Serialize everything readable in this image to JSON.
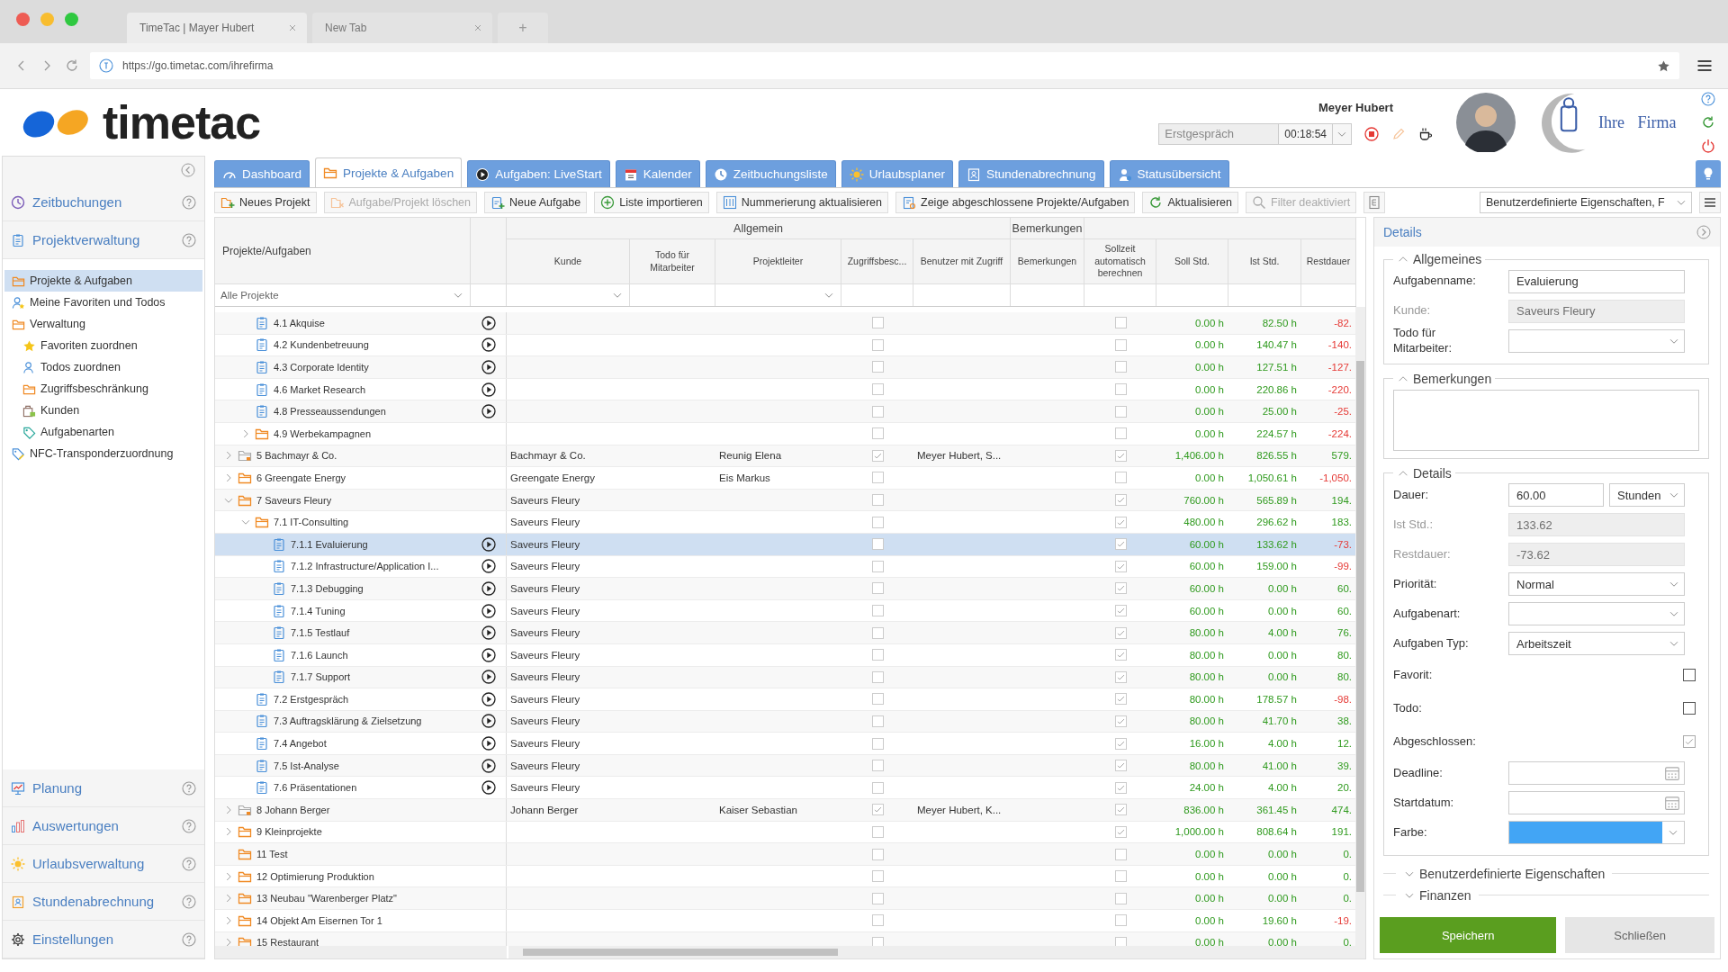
{
  "browser": {
    "tabs": [
      {
        "label": "TimeTac | Mayer Hubert",
        "selected": true
      },
      {
        "label": "New Tab",
        "selected": false
      }
    ],
    "new_tab": "+",
    "url": "https://go.timetac.com/ihrefirma"
  },
  "header": {
    "logo": "timetac",
    "user": "Meyer Hubert",
    "company": "Ihre Firma",
    "tracker": {
      "task": "Erstgespräch",
      "time": "00:18:54"
    }
  },
  "nav_tabs": [
    {
      "label": "Dashboard",
      "selected": false
    },
    {
      "label": "Projekte & Aufgaben",
      "selected": true
    },
    {
      "label": "Aufgaben: LiveStart",
      "selected": false
    },
    {
      "label": "Kalender",
      "selected": false
    },
    {
      "label": "Zeitbuchungsliste",
      "selected": false
    },
    {
      "label": "Urlaubsplaner",
      "selected": false
    },
    {
      "label": "Stundenabrechnung",
      "selected": false
    },
    {
      "label": "Statusübersicht",
      "selected": false
    }
  ],
  "toolbar": {
    "buttons": [
      {
        "label": "Neues Projekt",
        "disabled": false
      },
      {
        "label": "Aufgabe/Projekt löschen",
        "disabled": true
      },
      {
        "label": "Neue Aufgabe",
        "disabled": false
      },
      {
        "label": "Liste importieren",
        "disabled": false
      },
      {
        "label": "Nummerierung aktualisieren",
        "disabled": false
      },
      {
        "label": "Zeige abgeschlossene Projekte/Aufgaben",
        "disabled": false
      },
      {
        "label": "Aktualisieren",
        "disabled": false
      },
      {
        "label": "Filter deaktiviert",
        "disabled": true
      }
    ],
    "properties_select": "Benutzerdefinierte Eigenschaften, F"
  },
  "sidebar": {
    "sections": [
      {
        "label": "Zeitbuchungen"
      },
      {
        "label": "Projektverwaltung",
        "items": [
          {
            "label": "Projekte & Aufgaben",
            "selected": true
          },
          {
            "label": "Meine Favoriten und Todos",
            "selected": false
          },
          {
            "label": "Verwaltung",
            "selected": false,
            "children": [
              {
                "label": "Favoriten zuordnen",
                "selected": false
              },
              {
                "label": "Todos zuordnen",
                "selected": false
              },
              {
                "label": "Zugriffsbeschränkung",
                "selected": false
              },
              {
                "label": "Kunden",
                "selected": false
              },
              {
                "label": "Aufgabenarten",
                "selected": false
              }
            ]
          },
          {
            "label": "NFC-Transponderzuordnung",
            "selected": false
          }
        ]
      },
      {
        "label": "Planung"
      },
      {
        "label": "Auswertungen"
      },
      {
        "label": "Urlaubsverwaltung"
      },
      {
        "label": "Stundenabrechnung"
      },
      {
        "label": "Einstellungen"
      }
    ]
  },
  "table": {
    "name_column": "Projekte/Aufgaben",
    "name_filter": "Alle Projekte",
    "column_groups": [
      {
        "label": "Allgemein",
        "columns": [
          "Kunde",
          "Todo für Mitarbeiter",
          "Projektleiter",
          "Zugriffsbesc...",
          "Benutzer mit Zugriff"
        ]
      },
      {
        "label": "Bemerkungen",
        "columns": [
          "Bemerkungen"
        ]
      },
      {
        "columns": [
          "Sollzeit automatisch berechnen",
          "Soll Std.",
          "Ist Std.",
          "Restdauer"
        ]
      }
    ],
    "rows": [
      {
        "kind": "offscreen",
        "children": [
          {
            "kind": "task",
            "label": "4.1 Akquise",
            "selected": false,
            "access": false,
            "auto": false,
            "soll": "0.00 h",
            "ist": "82.50 h",
            "rest": "-82.",
            "negative": true
          },
          {
            "kind": "task",
            "label": "4.2 Kundenbetreuung",
            "selected": false,
            "access": false,
            "auto": false,
            "soll": "0.00 h",
            "ist": "140.47 h",
            "rest": "-140.",
            "negative": true
          },
          {
            "kind": "task",
            "label": "4.3 Corporate Identity",
            "selected": false,
            "access": false,
            "auto": false,
            "soll": "0.00 h",
            "ist": "127.51 h",
            "rest": "-127.",
            "negative": true
          },
          {
            "kind": "task",
            "label": "4.6 Market Research",
            "selected": false,
            "access": false,
            "auto": false,
            "soll": "0.00 h",
            "ist": "220.86 h",
            "rest": "-220.",
            "negative": true
          },
          {
            "kind": "task",
            "label": "4.8 Presseaussendungen",
            "selected": false,
            "access": false,
            "auto": false,
            "soll": "0.00 h",
            "ist": "25.00 h",
            "rest": "-25.",
            "negative": true
          },
          {
            "kind": "project",
            "label": "4.9 Werbekampagnen",
            "expanded": false,
            "selected": false,
            "access": false,
            "auto": false,
            "soll": "0.00 h",
            "ist": "224.57 h",
            "rest": "-224.",
            "negative": true
          }
        ]
      },
      {
        "kind": "customer_project",
        "label": "5 Bachmayr & Co.",
        "expanded": false,
        "selected": false,
        "customer": "Bachmayr & Co.",
        "lead": "Reunig Elena",
        "users": "Meyer Hubert, S...",
        "access": true,
        "auto": true,
        "soll": "1,406.00 h",
        "ist": "826.55 h",
        "rest": "579.",
        "negative": false
      },
      {
        "kind": "project",
        "label": "6 Greengate Energy",
        "expanded": false,
        "selected": false,
        "customer": "Greengate Energy",
        "lead": "Eis Markus",
        "access": false,
        "auto": false,
        "soll": "0.00 h",
        "ist": "1,050.61 h",
        "rest": "-1,050.",
        "negative": true
      },
      {
        "kind": "project",
        "label": "7 Saveurs Fleury",
        "expanded": true,
        "selected": false,
        "customer": "Saveurs Fleury",
        "access": false,
        "auto": true,
        "soll": "760.00 h",
        "ist": "565.89 h",
        "rest": "194.",
        "negative": false,
        "children": [
          {
            "kind": "project",
            "label": "7.1 IT-Consulting",
            "expanded": true,
            "selected": false,
            "customer": "Saveurs Fleury",
            "access": false,
            "auto": true,
            "soll": "480.00 h",
            "ist": "296.62 h",
            "rest": "183.",
            "negative": false,
            "children": [
              {
                "kind": "task",
                "label": "7.1.1 Evaluierung",
                "selected": true,
                "customer": "Saveurs Fleury",
                "access": false,
                "auto": true,
                "soll": "60.00 h",
                "ist": "133.62 h",
                "rest": "-73.",
                "negative": true
              },
              {
                "kind": "task",
                "label": "7.1.2 Infrastructure/Application I...",
                "selected": false,
                "customer": "Saveurs Fleury",
                "access": false,
                "auto": true,
                "soll": "60.00 h",
                "ist": "159.00 h",
                "rest": "-99.",
                "negative": true
              },
              {
                "kind": "task",
                "label": "7.1.3 Debugging",
                "selected": false,
                "customer": "Saveurs Fleury",
                "access": false,
                "auto": true,
                "soll": "60.00 h",
                "ist": "0.00 h",
                "rest": "60.",
                "negative": false
              },
              {
                "kind": "task",
                "label": "7.1.4 Tuning",
                "selected": false,
                "customer": "Saveurs Fleury",
                "access": false,
                "auto": true,
                "soll": "60.00 h",
                "ist": "0.00 h",
                "rest": "60.",
                "negative": false
              },
              {
                "kind": "task",
                "label": "7.1.5 Testlauf",
                "selected": false,
                "customer": "Saveurs Fleury",
                "access": false,
                "auto": true,
                "soll": "80.00 h",
                "ist": "4.00 h",
                "rest": "76.",
                "negative": false
              },
              {
                "kind": "task",
                "label": "7.1.6 Launch",
                "selected": false,
                "customer": "Saveurs Fleury",
                "access": false,
                "auto": true,
                "soll": "80.00 h",
                "ist": "0.00 h",
                "rest": "80.",
                "negative": false
              },
              {
                "kind": "task",
                "label": "7.1.7 Support",
                "selected": false,
                "customer": "Saveurs Fleury",
                "access": false,
                "auto": true,
                "soll": "80.00 h",
                "ist": "0.00 h",
                "rest": "80.",
                "negative": false
              }
            ]
          },
          {
            "kind": "task",
            "label": "7.2 Erstgespräch",
            "selected": false,
            "customer": "Saveurs Fleury",
            "access": false,
            "auto": true,
            "soll": "80.00 h",
            "ist": "178.57 h",
            "rest": "-98.",
            "negative": true
          },
          {
            "kind": "task",
            "label": "7.3 Auftragsklärung & Zielsetzung",
            "selected": false,
            "customer": "Saveurs Fleury",
            "access": false,
            "auto": true,
            "soll": "80.00 h",
            "ist": "41.70 h",
            "rest": "38.",
            "negative": false
          },
          {
            "kind": "task",
            "label": "7.4 Angebot",
            "selected": false,
            "customer": "Saveurs Fleury",
            "access": false,
            "auto": true,
            "soll": "16.00 h",
            "ist": "4.00 h",
            "rest": "12.",
            "negative": false
          },
          {
            "kind": "task",
            "label": "7.5 Ist-Analyse",
            "selected": false,
            "customer": "Saveurs Fleury",
            "access": false,
            "auto": true,
            "soll": "80.00 h",
            "ist": "41.00 h",
            "rest": "39.",
            "negative": false
          },
          {
            "kind": "task",
            "label": "7.6 Präsentationen",
            "selected": false,
            "customer": "Saveurs Fleury",
            "access": false,
            "auto": true,
            "soll": "24.00 h",
            "ist": "4.00 h",
            "rest": "20.",
            "negative": false
          }
        ]
      },
      {
        "kind": "customer_project",
        "label": "8 Johann Berger",
        "expanded": false,
        "selected": false,
        "customer": "Johann Berger",
        "lead": "Kaiser Sebastian",
        "users": "Meyer Hubert, K...",
        "access": true,
        "auto": true,
        "soll": "836.00 h",
        "ist": "361.45 h",
        "rest": "474.",
        "negative": false
      },
      {
        "kind": "project",
        "label": "9 Kleinprojekte",
        "expanded": false,
        "selected": false,
        "access": false,
        "auto": true,
        "soll": "1,000.00 h",
        "ist": "808.64 h",
        "rest": "191.",
        "negative": false
      },
      {
        "kind": "project",
        "label": "11 Test",
        "selected": false,
        "access": false,
        "auto": false,
        "soll": "0.00 h",
        "ist": "0.00 h",
        "rest": "0.",
        "negative": false
      },
      {
        "kind": "project",
        "label": "12 Optimierung Produktion",
        "expanded": false,
        "selected": false,
        "access": false,
        "auto": false,
        "soll": "0.00 h",
        "ist": "0.00 h",
        "rest": "0.",
        "negative": false
      },
      {
        "kind": "project",
        "label": "13 Neubau \"Warenberger Platz\"",
        "expanded": false,
        "selected": false,
        "access": false,
        "auto": false,
        "soll": "0.00 h",
        "ist": "0.00 h",
        "rest": "0.",
        "negative": false
      },
      {
        "kind": "project",
        "label": "14 Objekt Am Eisernen Tor 1",
        "expanded": false,
        "selected": false,
        "access": false,
        "auto": false,
        "soll": "0.00 h",
        "ist": "19.60 h",
        "rest": "-19.",
        "negative": true
      },
      {
        "kind": "project",
        "label": "15 Restaurant",
        "expanded": false,
        "selected": false,
        "access": false,
        "auto": false,
        "soll": "0.00 h",
        "ist": "0.00 h",
        "rest": "0.",
        "negative": false
      }
    ]
  },
  "details": {
    "title": "Details",
    "sections": [
      {
        "title": "Allgemeines",
        "expanded": true,
        "fields": [
          {
            "kind": "input",
            "label": "Aufgabenname:",
            "value": "Evaluierung"
          },
          {
            "kind": "readonly",
            "label": "Kunde:",
            "value": "Saveurs Fleury"
          },
          {
            "kind": "select",
            "label": "Todo für Mitarbeiter:"
          }
        ]
      },
      {
        "title": "Bemerkungen",
        "expanded": true,
        "fields": [
          {
            "kind": "textarea"
          }
        ]
      },
      {
        "title": "Details",
        "expanded": true,
        "fields": [
          {
            "kind": "duration",
            "label": "Dauer:",
            "value": "60.00",
            "unit": "Stunden"
          },
          {
            "kind": "readonly",
            "label": "Ist Std.:",
            "value": "133.62"
          },
          {
            "kind": "readonly",
            "label": "Restdauer:",
            "value": "-73.62"
          },
          {
            "kind": "select",
            "label": "Priorität:",
            "value": "Normal"
          },
          {
            "kind": "select",
            "label": "Aufgabenart:"
          },
          {
            "kind": "select",
            "label": "Aufgaben Typ:",
            "value": "Arbeitszeit"
          },
          {
            "kind": "checkbox",
            "label": "Favorit:",
            "checked": false,
            "disabled": false
          },
          {
            "kind": "checkbox",
            "label": "Todo:",
            "checked": false,
            "disabled": false
          },
          {
            "kind": "checkbox",
            "label": "Abgeschlossen:",
            "checked": true,
            "disabled": true
          },
          {
            "kind": "date",
            "label": "Deadline:"
          },
          {
            "kind": "date",
            "label": "Startdatum:"
          },
          {
            "kind": "color",
            "label": "Farbe:",
            "color": "#42a5f5"
          }
        ]
      },
      {
        "title": "Benutzerdefinierte Eigenschaften",
        "expanded": false
      },
      {
        "title": "Finanzen",
        "expanded": false
      }
    ],
    "buttons": [
      {
        "label": "Speichern",
        "primary": true
      },
      {
        "label": "Schließen",
        "primary": false
      }
    ]
  }
}
